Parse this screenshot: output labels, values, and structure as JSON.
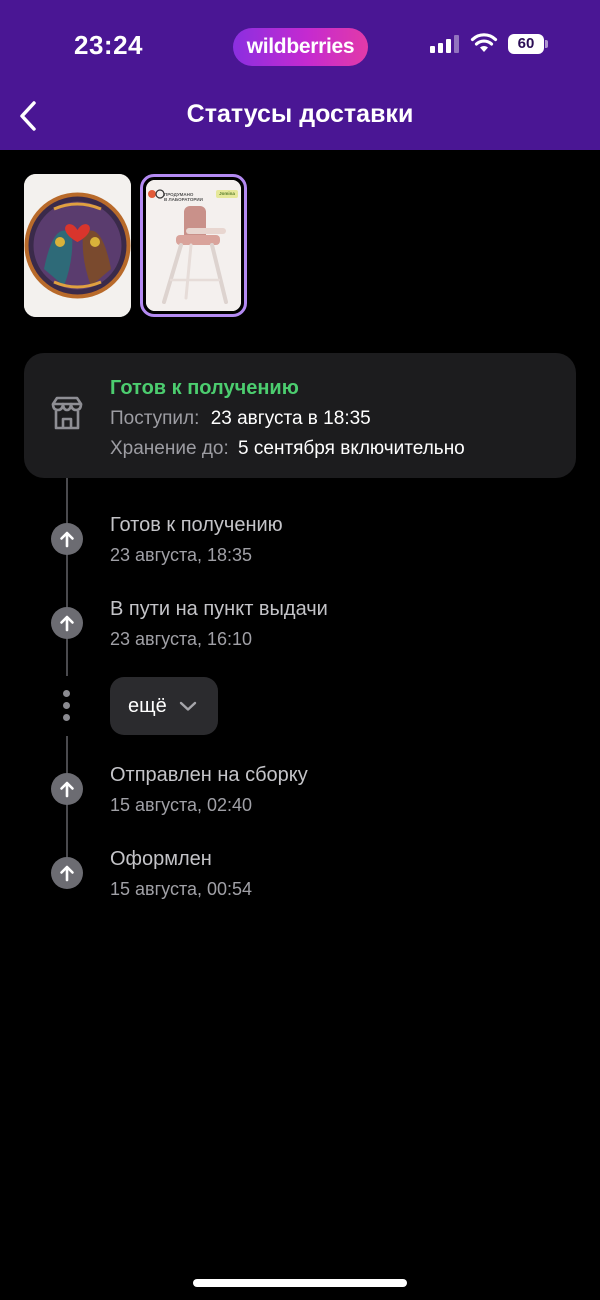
{
  "status_bar": {
    "time": "23:24",
    "brand": "wildberries",
    "battery": "60",
    "icons": [
      "signal-icon",
      "wifi-icon",
      "battery-icon"
    ]
  },
  "header": {
    "title": "Статусы доставки",
    "back_icon": "chevron-left-icon"
  },
  "products": [
    {
      "name": "puzzle-cats-heart",
      "selected": false
    },
    {
      "name": "baby-high-chair",
      "selected": true,
      "label_lines": [
        "ПРОДУМАНО",
        "В ЛАБОРАТОРИИ"
      ],
      "badge": "Jomina"
    }
  ],
  "status_card": {
    "status": "Готов к получению",
    "arrived_label": "Поступил:",
    "arrived_value": "23 августа в 18:35",
    "storage_label": "Хранение до:",
    "storage_value": "5 сентября включительно",
    "icon": "store-icon",
    "status_color": "#4ccd6f"
  },
  "timeline": [
    {
      "title": "Готов к получению",
      "date": "23 августа, 18:35"
    },
    {
      "title": "В пути на пункт выдачи",
      "date": "23 августа, 16:10"
    },
    {
      "title": "Отправлен на сборку",
      "date": "15 августа, 02:40"
    },
    {
      "title": "Оформлен",
      "date": "15 августа, 00:54"
    }
  ],
  "more_button": {
    "label": "ещё",
    "icon": "chevron-down-icon"
  },
  "colors": {
    "header_bg": "#4a1694",
    "accent_green": "#4ccd6f",
    "card_bg": "#1c1c1e",
    "selected_border": "#b48af2"
  }
}
